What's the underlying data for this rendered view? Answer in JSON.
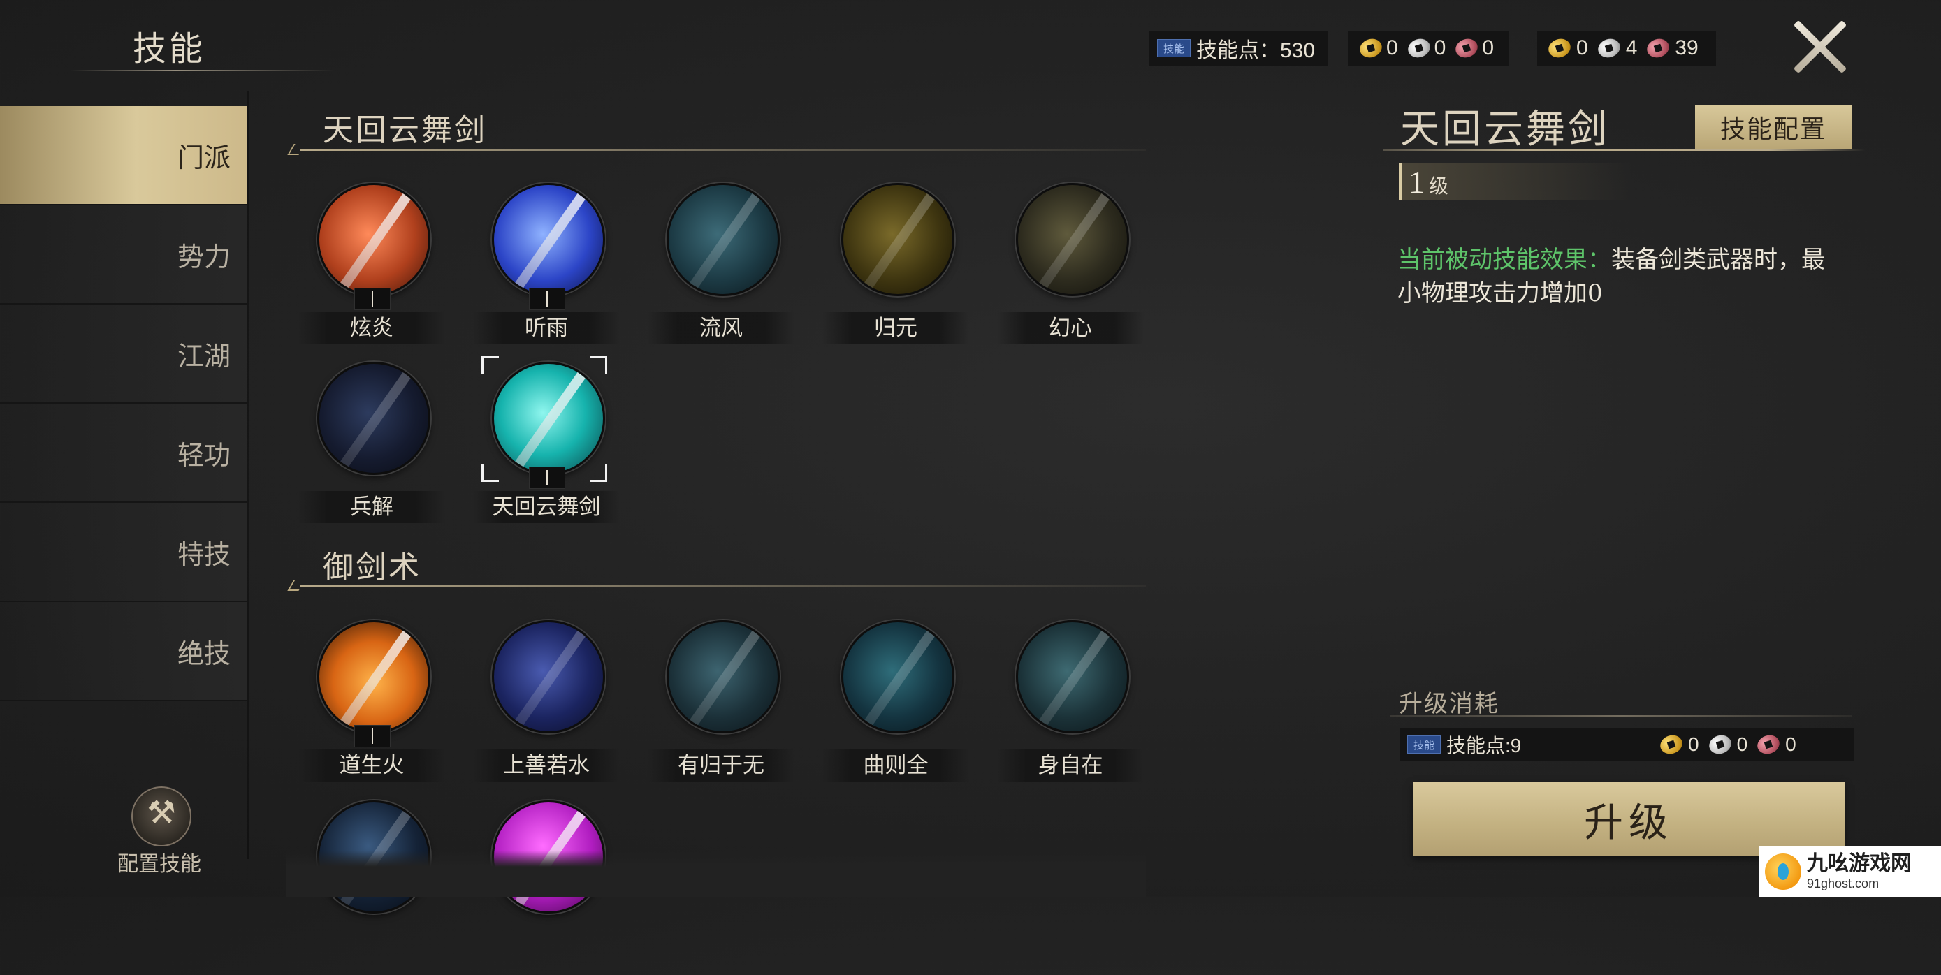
{
  "header": {
    "title": "技能",
    "skill_points": {
      "tag": "技能",
      "label": "技能点：530"
    },
    "currency_a": [
      {
        "icon": "gold-coin-icon",
        "value": "0"
      },
      {
        "icon": "silver-coin-icon",
        "value": "0"
      },
      {
        "icon": "copper-coin-icon",
        "value": "0"
      }
    ],
    "currency_b": [
      {
        "icon": "bound-gold-coin-icon",
        "value": "0"
      },
      {
        "icon": "bound-silver-coin-icon",
        "value": "4"
      },
      {
        "icon": "bound-copper-coin-icon",
        "value": "39"
      }
    ],
    "close_icon": "close-icon"
  },
  "sidebar": {
    "items": [
      {
        "label": "门派",
        "active": true
      },
      {
        "label": "势力",
        "active": false
      },
      {
        "label": "江湖",
        "active": false
      },
      {
        "label": "轻功",
        "active": false
      },
      {
        "label": "特技",
        "active": false
      },
      {
        "label": "绝技",
        "active": false
      }
    ],
    "config_label": "配置技能"
  },
  "sections": [
    {
      "title": "天回云舞剑",
      "skills": [
        {
          "name": "炫炎",
          "learned": true
        },
        {
          "name": "听雨",
          "learned": true
        },
        {
          "name": "流风",
          "learned": false
        },
        {
          "name": "归元",
          "learned": false
        },
        {
          "name": "幻心",
          "learned": false
        },
        {
          "name": "兵解",
          "learned": false
        },
        {
          "name": "天回云舞剑",
          "learned": true,
          "selected": true
        }
      ]
    },
    {
      "title": "御剑术",
      "skills": [
        {
          "name": "道生火",
          "learned": true
        },
        {
          "name": "上善若水",
          "learned": false
        },
        {
          "name": "有归于无",
          "learned": false
        },
        {
          "name": "曲则全",
          "learned": false
        },
        {
          "name": "身自在",
          "learned": false
        },
        {
          "name": "",
          "learned": false
        },
        {
          "name": "",
          "learned": false
        }
      ]
    }
  ],
  "detail": {
    "title": "天回云舞剑",
    "config_button": "技能配置",
    "level_num": "1",
    "level_unit": "级",
    "effect_label": "当前被动技能效果：",
    "effect_text": "装备剑类武器时，最小物理攻击力增加0",
    "cost_title": "升级消耗",
    "cost_skill_tag": "技能",
    "cost_skill_points": "技能点:9",
    "cost_coins": [
      {
        "icon": "gold-coin-icon",
        "value": "0"
      },
      {
        "icon": "silver-coin-icon",
        "value": "0"
      },
      {
        "icon": "copper-coin-icon",
        "value": "0"
      }
    ],
    "upgrade_button": "升级"
  },
  "watermark": {
    "name": "九吆游戏网",
    "url": "91ghost.com"
  }
}
